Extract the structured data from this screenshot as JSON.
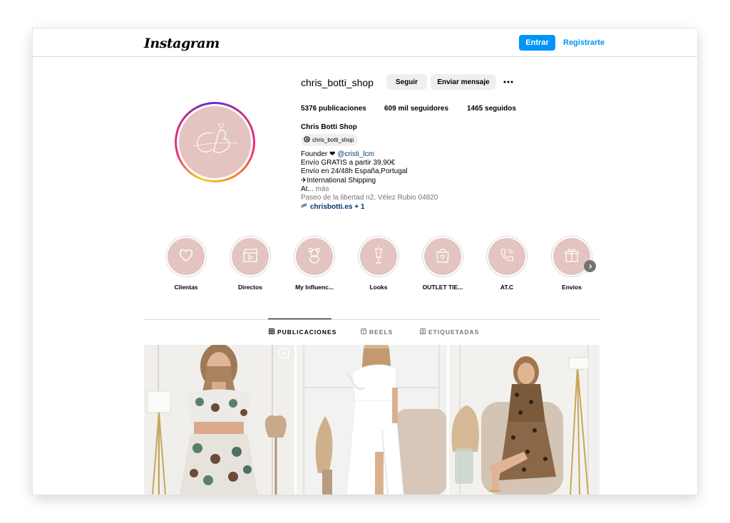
{
  "header": {
    "logo": "Instagram",
    "login_label": "Entrar",
    "signup_label": "Registrarte"
  },
  "profile": {
    "username": "chris_botti_shop",
    "follow_label": "Seguir",
    "message_label": "Enviar mensaje",
    "stats": {
      "posts": "5376 publicaciones",
      "followers": "609 mil seguidores",
      "following": "1465 seguidos"
    },
    "full_name": "Chris Botti Shop",
    "threads_handle": "chris_botti_shop",
    "bio": {
      "founder_prefix": "Founder ❤",
      "founder_mention": "@cristi_lcm",
      "line2": "Envío GRATIS a partir 39,90€",
      "line3": "Envío en 24/48h España,Portugal",
      "line4": "✈International Shipping",
      "line5_prefix": "At...",
      "line5_more": "más",
      "address": "Paseo de la libertad n2, Vélez Rubio 04820",
      "link": "chrisbotti.es + 1"
    }
  },
  "highlights": [
    {
      "label": "Clientas",
      "icon": "heart-icon"
    },
    {
      "label": "Directos",
      "icon": "clapperboard-icon"
    },
    {
      "label": "My Influenc...",
      "icon": "teddy-bear-icon"
    },
    {
      "label": "Looks",
      "icon": "dress-form-icon"
    },
    {
      "label": "OUTLET TIE...",
      "icon": "shopping-bag-icon"
    },
    {
      "label": "AT.C",
      "icon": "phone-icon"
    },
    {
      "label": "Envíos",
      "icon": "gift-box-icon"
    }
  ],
  "tabs": [
    {
      "label": "PUBLICACIONES",
      "icon": "grid-icon",
      "active": true
    },
    {
      "label": "REELS",
      "icon": "reels-icon",
      "active": false
    },
    {
      "label": "ETIQUETADAS",
      "icon": "tagged-icon",
      "active": false
    }
  ],
  "posts": [
    {
      "name": "post-floral-dress",
      "type": "reel"
    },
    {
      "name": "post-white-dress",
      "type": "photo"
    },
    {
      "name": "post-leopard-dress",
      "type": "photo"
    }
  ],
  "colors": {
    "accent": "#0095f6",
    "highlight_bg": "#e3c4c0",
    "link": "#00376b"
  }
}
